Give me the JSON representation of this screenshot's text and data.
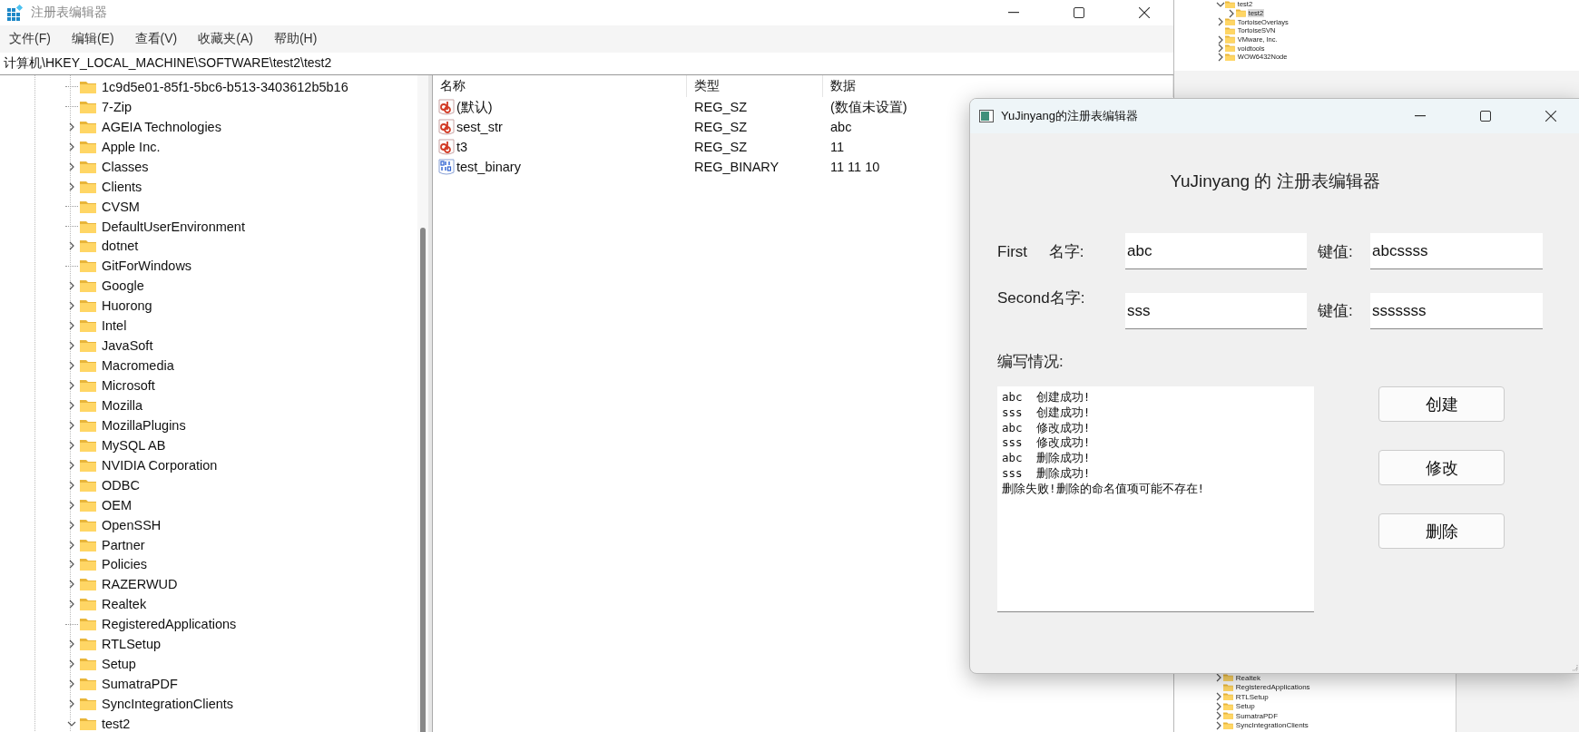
{
  "regedit": {
    "title": "注册表编辑器",
    "menu": [
      "文件(F)",
      "编辑(E)",
      "查看(V)",
      "收藏夹(A)",
      "帮助(H)"
    ],
    "address": "计算机\\HKEY_LOCAL_MACHINE\\SOFTWARE\\test2\\test2",
    "tree": [
      {
        "name": "1c9d5e01-85f1-5bc6-b513-3403612b5b16"
      },
      {
        "name": "7-Zip"
      },
      {
        "name": "AGEIA Technologies",
        "expanded": false
      },
      {
        "name": "Apple Inc.",
        "expanded": false
      },
      {
        "name": "Classes",
        "expanded": false
      },
      {
        "name": "Clients",
        "expanded": false
      },
      {
        "name": "CVSM"
      },
      {
        "name": "DefaultUserEnvironment"
      },
      {
        "name": "dotnet",
        "expanded": false
      },
      {
        "name": "GitForWindows"
      },
      {
        "name": "Google",
        "expanded": false
      },
      {
        "name": "Huorong",
        "expanded": false
      },
      {
        "name": "Intel",
        "expanded": false
      },
      {
        "name": "JavaSoft",
        "expanded": false
      },
      {
        "name": "Macromedia",
        "expanded": false
      },
      {
        "name": "Microsoft",
        "expanded": false
      },
      {
        "name": "Mozilla",
        "expanded": false
      },
      {
        "name": "MozillaPlugins",
        "expanded": false
      },
      {
        "name": "MySQL AB",
        "expanded": false
      },
      {
        "name": "NVIDIA Corporation",
        "expanded": false
      },
      {
        "name": "ODBC",
        "expanded": false
      },
      {
        "name": "OEM",
        "expanded": false
      },
      {
        "name": "OpenSSH",
        "expanded": false
      },
      {
        "name": "Partner",
        "expanded": false
      },
      {
        "name": "Policies",
        "expanded": false
      },
      {
        "name": "RAZERWUD",
        "expanded": false
      },
      {
        "name": "Realtek",
        "expanded": false
      },
      {
        "name": "RegisteredApplications"
      },
      {
        "name": "RTLSetup",
        "expanded": false
      },
      {
        "name": "Setup",
        "expanded": false
      },
      {
        "name": "SumatraPDF",
        "expanded": false
      },
      {
        "name": "SyncIntegrationClients",
        "expanded": false
      },
      {
        "name": "test2",
        "expanded": true
      }
    ],
    "columns": [
      "名称",
      "类型",
      "数据"
    ],
    "values": [
      {
        "kind": "string",
        "name": "(默认)",
        "type": "REG_SZ",
        "data": "(数值未设置)"
      },
      {
        "kind": "string",
        "name": "sest_str",
        "type": "REG_SZ",
        "data": "abc"
      },
      {
        "kind": "string",
        "name": "t3",
        "type": "REG_SZ",
        "data": "11"
      },
      {
        "kind": "binary",
        "name": "test_binary",
        "type": "REG_BINARY",
        "data": "11 11 10"
      }
    ]
  },
  "background_window": {
    "tree_top": [
      {
        "name": "test2",
        "expanded": true,
        "selected": false,
        "children": [
          {
            "name": "test2",
            "expanded": false,
            "selected": true
          }
        ]
      },
      {
        "name": "TortoiseOverlays",
        "expanded": false,
        "selected": false
      },
      {
        "name": "TortoiseSVN",
        "selected": false
      },
      {
        "name": "VMware, Inc.",
        "expanded": false,
        "selected": false
      },
      {
        "name": "voidtools",
        "expanded": false,
        "selected": false
      },
      {
        "name": "WOW6432Node",
        "expanded": false,
        "selected": false
      }
    ],
    "tree_bottom": [
      {
        "name": "Realtek",
        "expanded": false,
        "selected": false
      },
      {
        "name": "RegisteredApplications",
        "selected": false
      },
      {
        "name": "RTLSetup",
        "expanded": false,
        "selected": false
      },
      {
        "name": "Setup",
        "expanded": false,
        "selected": false
      },
      {
        "name": "SumatraPDF",
        "expanded": false,
        "selected": false
      },
      {
        "name": "SyncIntegrationClients",
        "expanded": false,
        "selected": false
      }
    ]
  },
  "dialog": {
    "title": "YuJinyang的注册表编辑器",
    "heading": "YuJinyang 的 注册表编辑器",
    "rows": [
      {
        "label": "First     名字:",
        "name_value": "abc",
        "key_label": "键值:",
        "key_value": "abcssss"
      },
      {
        "label": "Second名字:",
        "name_value": "sss",
        "key_label": "键值:",
        "key_value": "sssssss"
      }
    ],
    "log_label": "编写情况:",
    "log": [
      "abc  创建成功!",
      "sss  创建成功!",
      "abc  修改成功!",
      "sss  修改成功!",
      "abc  删除成功!",
      "sss  删除成功!",
      "删除失败!删除的命名值项可能不存在!"
    ],
    "buttons": [
      "创建",
      "修改",
      "删除"
    ]
  }
}
